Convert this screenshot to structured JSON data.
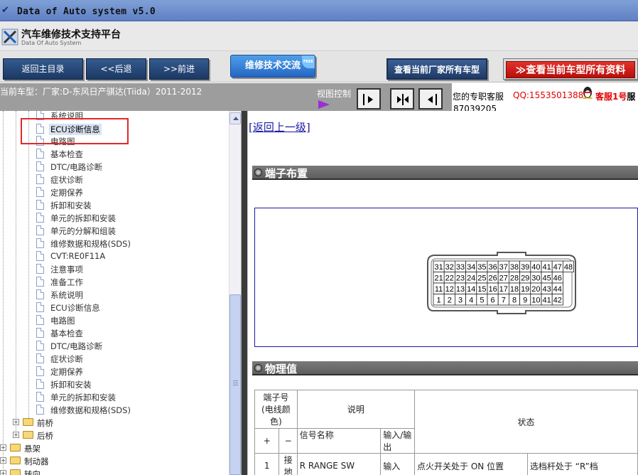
{
  "window": {
    "title": "Data of Auto system v5.0"
  },
  "header": {
    "title": "汽车维修技术支持平台",
    "subtitle": "Data Of Auto System"
  },
  "toolbar": {
    "home": "返回主目录",
    "back": "<<后退",
    "forward": ">>前进",
    "exchange": "维修技术交流",
    "free_badge": "FREE",
    "all_models": "查看当前厂家所有车型",
    "all_data": "查看当前车型所有资料"
  },
  "infobar": {
    "car": "当前车型：厂家:D-东风日产骐达(Tiida）2011-2012",
    "view_control": "视图控制"
  },
  "service": {
    "text": "您的专职客服",
    "qq": "QQ:1553501388",
    "kf": "客服1号",
    "kf_tail": "服",
    "phone": "87039205"
  },
  "tree": {
    "items": [
      "系统说明",
      "ECU诊断信息",
      "电路图",
      "基本检查",
      "DTC/电路诊断",
      "症状诊断",
      "定期保养",
      "拆卸和安装",
      "单元的拆卸和安装",
      "单元的分解和组装",
      "维修数据和规格(SDS)",
      "CVT:RE0F11A",
      "注意事项",
      "准备工作",
      "系统说明",
      "ECU诊断信息",
      "电路图",
      "基本检查",
      "DTC/电路诊断",
      "症状诊断",
      "定期保养",
      "拆卸和安装",
      "单元的拆卸和安装",
      "维修数据和规格(SDS)"
    ],
    "folders": [
      "前桥",
      "后桥",
      "悬架",
      "制动器",
      "转向"
    ],
    "expander": "+"
  },
  "content": {
    "back_link": "[返回上一级]",
    "section1": "端子布置",
    "section2": "物理值",
    "connector": {
      "rows": [
        [
          "31",
          "32",
          "33",
          "34",
          "35",
          "36",
          "37",
          "38",
          "39",
          "40",
          "41",
          "47",
          "48"
        ],
        [
          "21",
          "22",
          "23",
          "24",
          "25",
          "26",
          "27",
          "28",
          "29",
          "30",
          "45",
          "46"
        ],
        [
          "11",
          "12",
          "13",
          "14",
          "15",
          "16",
          "17",
          "18",
          "19",
          "20",
          "43",
          "44"
        ],
        [
          "1",
          "2",
          "3",
          "4",
          "5",
          "6",
          "7",
          "8",
          "9",
          "10",
          "41",
          "42"
        ]
      ]
    },
    "table": {
      "h_terminal": "端子号 (电线颜色)",
      "h_desc": "说明",
      "h_state": "状态",
      "h_plus": "+",
      "h_minus": "−",
      "h_signal": "信号名称",
      "h_io": "输入/输出",
      "row1": {
        "plus": "1",
        "minus": "接地",
        "signal": "R RANGE SW",
        "io": "输入",
        "cond": "点火开关处于 ON 位置",
        "state": "选档杆处于 “R”档"
      }
    }
  }
}
